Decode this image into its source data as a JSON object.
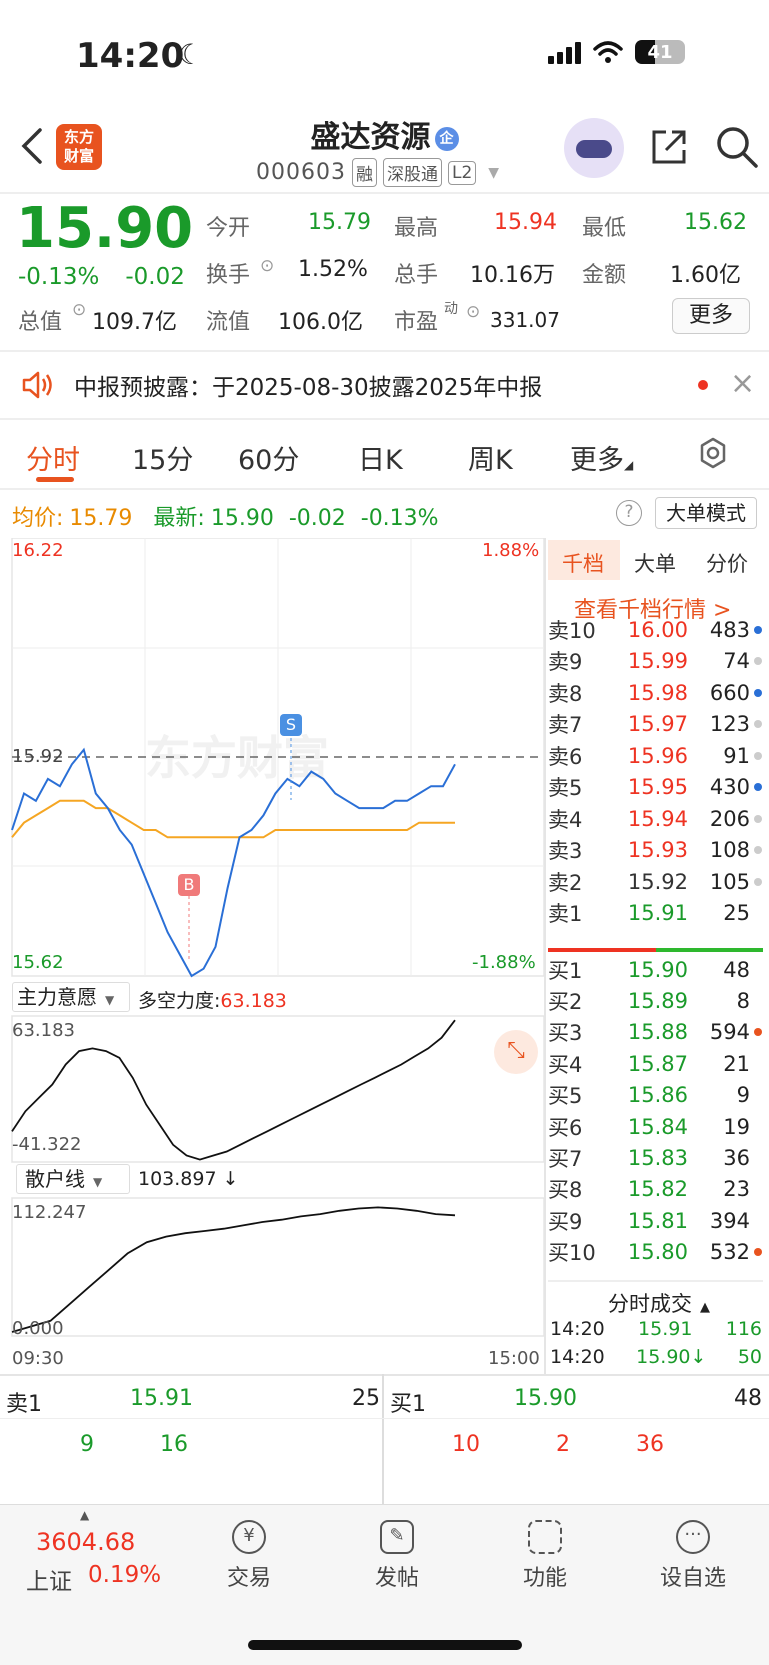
{
  "status": {
    "time": "14:20",
    "moon": "☾",
    "battery": "41"
  },
  "header": {
    "logo_line1": "东方",
    "logo_line2": "财富",
    "name": "盛达资源",
    "name_badge": "企",
    "code": "000603",
    "tags": [
      "融",
      "深股通",
      "L2"
    ]
  },
  "quote": {
    "price": "15.90",
    "change_pct": "-0.13%",
    "change": "-0.02",
    "open_label": "今开",
    "open": "15.79",
    "high_label": "最高",
    "high": "15.94",
    "low_label": "最低",
    "low": "15.62",
    "turnover_label": "换手",
    "turnover": "1.52%",
    "volume_label": "总手",
    "volume": "10.16万",
    "amount_label": "金额",
    "amount": "1.60亿",
    "mcap_label": "总值",
    "mcap": "109.7亿",
    "float_label": "流值",
    "float": "106.0亿",
    "pe_label": "市盈",
    "pe_sup": "动",
    "pe": "331.07",
    "more": "更多"
  },
  "notice": {
    "text": "中报预披露：于2025-08-30披露2025年中报",
    "close": "×"
  },
  "tabs": [
    "分时",
    "15分",
    "60分",
    "日K",
    "周K",
    "更多"
  ],
  "info": {
    "avg_label": "均价:",
    "avg": "15.79",
    "latest_label": "最新:",
    "latest": "15.90",
    "latest_chg": "-0.02",
    "latest_pct": "-0.13%",
    "help": "?",
    "mode": "大单模式"
  },
  "chart_labels": {
    "ymax": "16.22",
    "ymin": "15.62",
    "ymid": "15.92",
    "pct_max": "1.88%",
    "pct_min": "-1.88%",
    "sell_marker": "S",
    "buy_marker": "B",
    "watermark": "东方财富",
    "ind1_name": "主力意愿",
    "ind1_label": "多空力度:",
    "ind1_value": "63.183",
    "ind1_max": "63.183",
    "ind1_min": "-41.322",
    "ind2_name": "散户线",
    "ind2_value": "103.897 ↓",
    "ind2_max": "112.247",
    "ind2_min": "0.000",
    "time_start": "09:30",
    "time_end": "15:00"
  },
  "chart_data": {
    "type": "line",
    "x_range": [
      "09:30",
      "15:00"
    ],
    "ylim": [
      15.62,
      16.22
    ],
    "ref_price": 15.92,
    "series": [
      {
        "values": [
          15.82,
          15.87,
          15.86,
          15.89,
          15.88,
          15.91,
          15.93,
          15.87,
          15.85,
          15.82,
          15.8,
          15.76,
          15.72,
          15.68,
          15.65,
          15.62,
          15.63,
          15.66,
          15.74,
          15.81,
          15.82,
          15.84,
          15.87,
          15.89,
          15.88,
          15.9,
          15.89,
          15.87,
          15.86,
          15.85,
          15.85,
          15.85,
          15.86,
          15.86,
          15.87,
          15.88,
          15.88,
          15.91
        ]
      },
      {
        "values": [
          15.81,
          15.83,
          15.84,
          15.85,
          15.86,
          15.86,
          15.86,
          15.85,
          15.85,
          15.84,
          15.83,
          15.82,
          15.82,
          15.81,
          15.81,
          15.81,
          15.81,
          15.81,
          15.81,
          15.81,
          15.81,
          15.81,
          15.82,
          15.82,
          15.82,
          15.82,
          15.82,
          15.82,
          15.82,
          15.82,
          15.82,
          15.82,
          15.82,
          15.82,
          15.83,
          15.83,
          15.83,
          15.83
        ]
      }
    ],
    "indicator1": {
      "ylim": [
        -41.322,
        63.183
      ],
      "values": [
        -20,
        -5,
        5,
        15,
        30,
        40,
        42,
        40,
        35,
        20,
        0,
        -15,
        -30,
        -38,
        -41,
        -38,
        -35,
        -30,
        -25,
        -20,
        -15,
        -10,
        -5,
        0,
        5,
        10,
        15,
        20,
        25,
        30,
        36,
        42,
        50,
        63
      ]
    },
    "indicator2": {
      "ylim": [
        0,
        112.247
      ],
      "values": [
        0,
        5,
        10,
        25,
        40,
        55,
        70,
        80,
        85,
        88,
        90,
        92,
        95,
        98,
        100,
        103,
        105,
        108,
        110,
        111,
        110,
        108,
        105,
        104
      ]
    }
  },
  "side": {
    "tabs": [
      "千档",
      "大单",
      "分价"
    ],
    "link": "查看千档行情 >",
    "asks": [
      {
        "label": "卖10",
        "price": "16.00",
        "vol": "483",
        "dot": "#2a6fd6"
      },
      {
        "label": "卖9",
        "price": "15.99",
        "vol": "74",
        "dot": "#ccc"
      },
      {
        "label": "卖8",
        "price": "15.98",
        "vol": "660",
        "dot": "#2a6fd6"
      },
      {
        "label": "卖7",
        "price": "15.97",
        "vol": "123",
        "dot": "#ccc"
      },
      {
        "label": "卖6",
        "price": "15.96",
        "vol": "91",
        "dot": "#ccc"
      },
      {
        "label": "卖5",
        "price": "15.95",
        "vol": "430",
        "dot": "#2a6fd6"
      },
      {
        "label": "卖4",
        "price": "15.94",
        "vol": "206",
        "dot": "#ccc"
      },
      {
        "label": "卖3",
        "price": "15.93",
        "vol": "108",
        "dot": "#ccc"
      },
      {
        "label": "卖2",
        "price": "15.92",
        "vol": "105",
        "dot": "#ccc"
      },
      {
        "label": "卖1",
        "price": "15.91",
        "vol": "25",
        "dot": ""
      }
    ],
    "bids": [
      {
        "label": "买1",
        "price": "15.90",
        "vol": "48",
        "dot": ""
      },
      {
        "label": "买2",
        "price": "15.89",
        "vol": "8",
        "dot": ""
      },
      {
        "label": "买3",
        "price": "15.88",
        "vol": "594",
        "dot": "#e8531f"
      },
      {
        "label": "买4",
        "price": "15.87",
        "vol": "21",
        "dot": ""
      },
      {
        "label": "买5",
        "price": "15.86",
        "vol": "9",
        "dot": ""
      },
      {
        "label": "买6",
        "price": "15.84",
        "vol": "19",
        "dot": ""
      },
      {
        "label": "买7",
        "price": "15.83",
        "vol": "36",
        "dot": ""
      },
      {
        "label": "买8",
        "price": "15.82",
        "vol": "23",
        "dot": ""
      },
      {
        "label": "买9",
        "price": "15.81",
        "vol": "394",
        "dot": ""
      },
      {
        "label": "买10",
        "price": "15.80",
        "vol": "532",
        "dot": "#e8531f"
      }
    ],
    "trades_title": "分时成交",
    "trades": [
      {
        "time": "14:20",
        "price": "15.91",
        "vol": "116"
      },
      {
        "time": "14:20",
        "price": "15.90↓",
        "vol": "50"
      }
    ]
  },
  "bottom_quote": {
    "ask_label": "卖1",
    "ask_price": "15.91",
    "ask_vol": "25",
    "bid_label": "买1",
    "bid_price": "15.90",
    "bid_vol": "48",
    "ask_queue": [
      "9",
      "16"
    ],
    "bid_queue": [
      "10",
      "2",
      "36"
    ]
  },
  "nav": {
    "index_value": "3604.68",
    "index_name": "上证",
    "index_pct": "0.19%",
    "items": [
      "交易",
      "发帖",
      "功能",
      "设自选"
    ]
  }
}
